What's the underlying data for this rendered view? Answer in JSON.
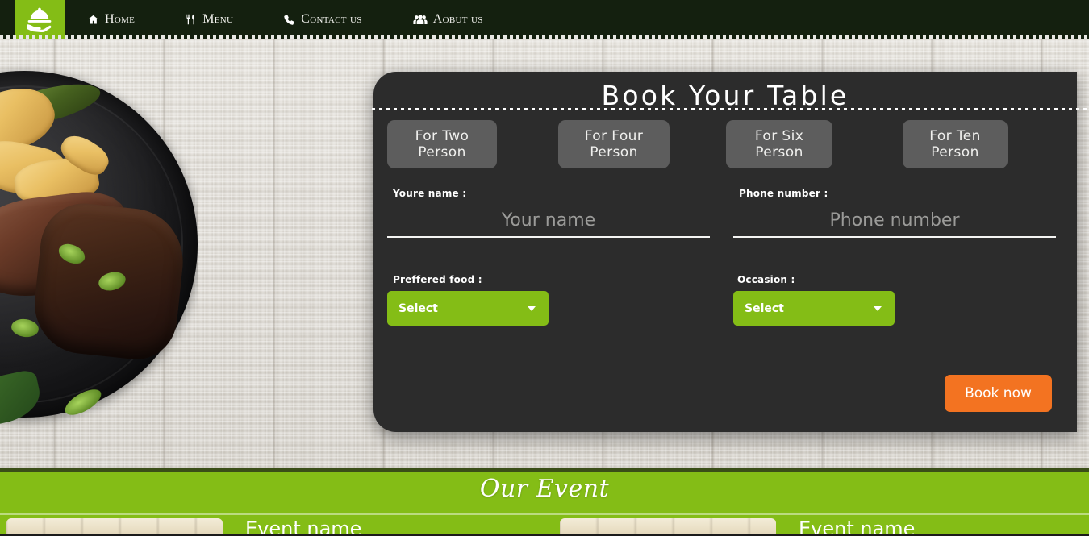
{
  "nav": {
    "logo_icon": "cloche-on-hand-icon",
    "items": [
      {
        "label": "Home",
        "icon": "home-icon"
      },
      {
        "label": "Menu",
        "icon": "fork-knife-icon"
      },
      {
        "label": "Contact us",
        "icon": "phone-icon"
      },
      {
        "label": "Aobut us",
        "icon": "users-group-icon"
      }
    ]
  },
  "booking": {
    "title": "Book Your Table",
    "party_sizes": [
      "For Two Person",
      "For Four Person",
      "For Six Person",
      "For Ten Person"
    ],
    "name_label": "Youre name :",
    "name_value": "",
    "name_placeholder": "Your name",
    "phone_label": "Phone number :",
    "phone_value": "",
    "phone_placeholder": "Phone number",
    "food_label": "Preffered food :",
    "food_selected": "Select",
    "occasion_label": "Occasion :",
    "occasion_selected": "Select",
    "submit_label": "Book now",
    "accent_green": "#84bd16",
    "accent_orange": "#f37321",
    "panel_bg": "#2c2c2c"
  },
  "events": {
    "section_title": "Our Event",
    "cards": [
      {
        "name": "Event name"
      },
      {
        "name": "Event name"
      }
    ]
  }
}
